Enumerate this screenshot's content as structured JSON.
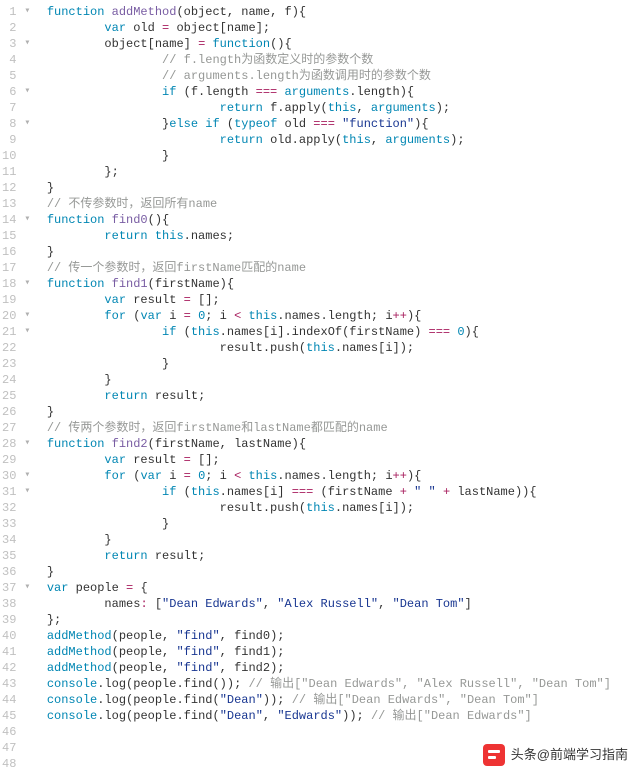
{
  "watermark": "头条@前端学习指南",
  "lines": [
    {
      "n": 1,
      "fold": "▾",
      "indent": 0,
      "tokens": [
        [
          "kw2",
          "function"
        ],
        [
          "",
          ""
        ],
        [
          "fn",
          " addMethod"
        ],
        [
          "",
          "("
        ],
        [
          "id",
          "object"
        ],
        [
          "",
          ", "
        ],
        [
          "id",
          "name"
        ],
        [
          "",
          ", "
        ],
        [
          "id",
          "f"
        ],
        [
          "",
          "){"
        ]
      ]
    },
    {
      "n": 2,
      "fold": "",
      "indent": 2,
      "tokens": [
        [
          "kw2",
          "var"
        ],
        [
          "",
          " "
        ],
        [
          "id",
          "old"
        ],
        [
          "",
          " "
        ],
        [
          "op",
          "="
        ],
        [
          "",
          " "
        ],
        [
          "id",
          "object"
        ],
        [
          "",
          "["
        ],
        [
          "id",
          "name"
        ],
        [
          "",
          "];"
        ]
      ]
    },
    {
      "n": 3,
      "fold": "▾",
      "indent": 2,
      "tokens": [
        [
          "id",
          "object"
        ],
        [
          "",
          "["
        ],
        [
          "id",
          "name"
        ],
        [
          "",
          "] "
        ],
        [
          "op",
          "="
        ],
        [
          "",
          " "
        ],
        [
          "kw2",
          "function"
        ],
        [
          "",
          "(){"
        ]
      ]
    },
    {
      "n": 4,
      "fold": "",
      "indent": 4,
      "tokens": [
        [
          "com",
          "// f.length为函数定义时的参数个数"
        ]
      ]
    },
    {
      "n": 5,
      "fold": "",
      "indent": 4,
      "tokens": [
        [
          "com",
          "// arguments.length为函数调用时的参数个数"
        ]
      ]
    },
    {
      "n": 6,
      "fold": "▾",
      "indent": 4,
      "tokens": [
        [
          "kw2",
          "if"
        ],
        [
          "",
          " ("
        ],
        [
          "id",
          "f"
        ],
        [
          "",
          ".length "
        ],
        [
          "op",
          "==="
        ],
        [
          "",
          " "
        ],
        [
          "builtin",
          "arguments"
        ],
        [
          "",
          ".length){"
        ]
      ]
    },
    {
      "n": 7,
      "fold": "",
      "indent": 6,
      "tokens": [
        [
          "kw2",
          "return"
        ],
        [
          "",
          " "
        ],
        [
          "id",
          "f"
        ],
        [
          "",
          ".apply("
        ],
        [
          "this",
          "this"
        ],
        [
          "",
          ", "
        ],
        [
          "builtin",
          "arguments"
        ],
        [
          "",
          ");"
        ]
      ]
    },
    {
      "n": 8,
      "fold": "▾",
      "indent": 4,
      "tokens": [
        [
          "",
          "}"
        ],
        [
          "kw2",
          "else if"
        ],
        [
          "",
          " ("
        ],
        [
          "kw2",
          "typeof"
        ],
        [
          "",
          " "
        ],
        [
          "id",
          "old"
        ],
        [
          "",
          " "
        ],
        [
          "op",
          "==="
        ],
        [
          "",
          " "
        ],
        [
          "str",
          "\"function\""
        ],
        [
          "",
          "){"
        ]
      ]
    },
    {
      "n": 9,
      "fold": "",
      "indent": 6,
      "tokens": [
        [
          "kw2",
          "return"
        ],
        [
          "",
          " "
        ],
        [
          "id",
          "old"
        ],
        [
          "",
          ".apply("
        ],
        [
          "this",
          "this"
        ],
        [
          "",
          ", "
        ],
        [
          "builtin",
          "arguments"
        ],
        [
          "",
          ");"
        ]
      ]
    },
    {
      "n": 10,
      "fold": "",
      "indent": 4,
      "tokens": [
        [
          "",
          "}"
        ]
      ]
    },
    {
      "n": 11,
      "fold": "",
      "indent": 2,
      "tokens": [
        [
          "",
          "};"
        ]
      ]
    },
    {
      "n": 12,
      "fold": "",
      "indent": 0,
      "tokens": [
        [
          "",
          "}"
        ]
      ]
    },
    {
      "n": 13,
      "fold": "",
      "indent": 0,
      "tokens": [
        [
          "com",
          "// 不传参数时，返回所有name"
        ]
      ]
    },
    {
      "n": 14,
      "fold": "▾",
      "indent": 0,
      "tokens": [
        [
          "kw2",
          "function"
        ],
        [
          "",
          " "
        ],
        [
          "fn",
          "find0"
        ],
        [
          "",
          "(){"
        ]
      ]
    },
    {
      "n": 15,
      "fold": "",
      "indent": 2,
      "tokens": [
        [
          "kw2",
          "return"
        ],
        [
          "",
          " "
        ],
        [
          "this",
          "this"
        ],
        [
          "",
          ".names;"
        ]
      ]
    },
    {
      "n": 16,
      "fold": "",
      "indent": 0,
      "tokens": [
        [
          "",
          "}"
        ]
      ]
    },
    {
      "n": 17,
      "fold": "",
      "indent": 0,
      "tokens": [
        [
          "com",
          "// 传一个参数时，返回firstName匹配的name"
        ]
      ]
    },
    {
      "n": 18,
      "fold": "▾",
      "indent": 0,
      "tokens": [
        [
          "kw2",
          "function"
        ],
        [
          "",
          " "
        ],
        [
          "fn",
          "find1"
        ],
        [
          "",
          "("
        ],
        [
          "id",
          "firstName"
        ],
        [
          "",
          "){"
        ]
      ]
    },
    {
      "n": 19,
      "fold": "",
      "indent": 2,
      "tokens": [
        [
          "kw2",
          "var"
        ],
        [
          "",
          " "
        ],
        [
          "id",
          "result"
        ],
        [
          "",
          " "
        ],
        [
          "op",
          "="
        ],
        [
          "",
          " [];"
        ]
      ]
    },
    {
      "n": 20,
      "fold": "▾",
      "indent": 2,
      "tokens": [
        [
          "kw2",
          "for"
        ],
        [
          "",
          " ("
        ],
        [
          "kw2",
          "var"
        ],
        [
          "",
          " "
        ],
        [
          "id",
          "i"
        ],
        [
          "",
          " "
        ],
        [
          "op",
          "="
        ],
        [
          "",
          " "
        ],
        [
          "num",
          "0"
        ],
        [
          "",
          "; "
        ],
        [
          "id",
          "i"
        ],
        [
          "",
          " "
        ],
        [
          "op",
          "<"
        ],
        [
          "",
          " "
        ],
        [
          "this",
          "this"
        ],
        [
          "",
          ".names.length; "
        ],
        [
          "id",
          "i"
        ],
        [
          "op",
          "++"
        ],
        [
          "",
          "){"
        ]
      ]
    },
    {
      "n": 21,
      "fold": "▾",
      "indent": 4,
      "tokens": [
        [
          "kw2",
          "if"
        ],
        [
          "",
          " ("
        ],
        [
          "this",
          "this"
        ],
        [
          "",
          ".names["
        ],
        [
          "id",
          "i"
        ],
        [
          "",
          "].indexOf("
        ],
        [
          "id",
          "firstName"
        ],
        [
          "",
          ") "
        ],
        [
          "op",
          "==="
        ],
        [
          "",
          " "
        ],
        [
          "num",
          "0"
        ],
        [
          "",
          "){"
        ]
      ]
    },
    {
      "n": 22,
      "fold": "",
      "indent": 6,
      "tokens": [
        [
          "id",
          "result"
        ],
        [
          "",
          ".push("
        ],
        [
          "this",
          "this"
        ],
        [
          "",
          ".names["
        ],
        [
          "id",
          "i"
        ],
        [
          "",
          "]);"
        ]
      ]
    },
    {
      "n": 23,
      "fold": "",
      "indent": 4,
      "tokens": [
        [
          "",
          "}"
        ]
      ]
    },
    {
      "n": 24,
      "fold": "",
      "indent": 2,
      "tokens": [
        [
          "",
          "}"
        ]
      ]
    },
    {
      "n": 25,
      "fold": "",
      "indent": 2,
      "tokens": [
        [
          "kw2",
          "return"
        ],
        [
          "",
          " "
        ],
        [
          "id",
          "result"
        ],
        [
          "",
          ";"
        ]
      ]
    },
    {
      "n": 26,
      "fold": "",
      "indent": 0,
      "tokens": [
        [
          "",
          "}"
        ]
      ]
    },
    {
      "n": 27,
      "fold": "",
      "indent": 0,
      "tokens": [
        [
          "com",
          "// 传两个参数时，返回firstName和lastName都匹配的name"
        ]
      ]
    },
    {
      "n": 28,
      "fold": "▾",
      "indent": 0,
      "tokens": [
        [
          "kw2",
          "function"
        ],
        [
          "",
          " "
        ],
        [
          "fn",
          "find2"
        ],
        [
          "",
          "("
        ],
        [
          "id",
          "firstName"
        ],
        [
          "",
          ", "
        ],
        [
          "id",
          "lastName"
        ],
        [
          "",
          "){"
        ]
      ]
    },
    {
      "n": 29,
      "fold": "",
      "indent": 2,
      "tokens": [
        [
          "kw2",
          "var"
        ],
        [
          "",
          " "
        ],
        [
          "id",
          "result"
        ],
        [
          "",
          " "
        ],
        [
          "op",
          "="
        ],
        [
          "",
          " [];"
        ]
      ]
    },
    {
      "n": 30,
      "fold": "▾",
      "indent": 2,
      "tokens": [
        [
          "kw2",
          "for"
        ],
        [
          "",
          " ("
        ],
        [
          "kw2",
          "var"
        ],
        [
          "",
          " "
        ],
        [
          "id",
          "i"
        ],
        [
          "",
          " "
        ],
        [
          "op",
          "="
        ],
        [
          "",
          " "
        ],
        [
          "num",
          "0"
        ],
        [
          "",
          "; "
        ],
        [
          "id",
          "i"
        ],
        [
          "",
          " "
        ],
        [
          "op",
          "<"
        ],
        [
          "",
          " "
        ],
        [
          "this",
          "this"
        ],
        [
          "",
          ".names.length; "
        ],
        [
          "id",
          "i"
        ],
        [
          "op",
          "++"
        ],
        [
          "",
          "){"
        ]
      ]
    },
    {
      "n": 31,
      "fold": "▾",
      "indent": 4,
      "tokens": [
        [
          "kw2",
          "if"
        ],
        [
          "",
          " ("
        ],
        [
          "this",
          "this"
        ],
        [
          "",
          ".names["
        ],
        [
          "id",
          "i"
        ],
        [
          "",
          "] "
        ],
        [
          "op",
          "==="
        ],
        [
          "",
          " ("
        ],
        [
          "id",
          "firstName"
        ],
        [
          "",
          " "
        ],
        [
          "op",
          "+"
        ],
        [
          "",
          " "
        ],
        [
          "str",
          "\" \""
        ],
        [
          "",
          " "
        ],
        [
          "op",
          "+"
        ],
        [
          "",
          " "
        ],
        [
          "id",
          "lastName"
        ],
        [
          "",
          ")){"
        ]
      ]
    },
    {
      "n": 32,
      "fold": "",
      "indent": 6,
      "tokens": [
        [
          "id",
          "result"
        ],
        [
          "",
          ".push("
        ],
        [
          "this",
          "this"
        ],
        [
          "",
          ".names["
        ],
        [
          "id",
          "i"
        ],
        [
          "",
          "]);"
        ]
      ]
    },
    {
      "n": 33,
      "fold": "",
      "indent": 4,
      "tokens": [
        [
          "",
          "}"
        ]
      ]
    },
    {
      "n": 34,
      "fold": "",
      "indent": 2,
      "tokens": [
        [
          "",
          "}"
        ]
      ]
    },
    {
      "n": 35,
      "fold": "",
      "indent": 2,
      "tokens": [
        [
          "kw2",
          "return"
        ],
        [
          "",
          " "
        ],
        [
          "id",
          "result"
        ],
        [
          "",
          ";"
        ]
      ]
    },
    {
      "n": 36,
      "fold": "",
      "indent": 0,
      "tokens": [
        [
          "",
          "}"
        ]
      ]
    },
    {
      "n": 37,
      "fold": "▾",
      "indent": 0,
      "tokens": [
        [
          "kw2",
          "var"
        ],
        [
          "",
          " "
        ],
        [
          "id",
          "people"
        ],
        [
          "",
          " "
        ],
        [
          "op",
          "="
        ],
        [
          "",
          " {"
        ]
      ]
    },
    {
      "n": 38,
      "fold": "",
      "indent": 2,
      "tokens": [
        [
          "id",
          "names"
        ],
        [
          "op",
          ":"
        ],
        [
          "",
          " ["
        ],
        [
          "str",
          "\"Dean Edwards\""
        ],
        [
          "",
          ", "
        ],
        [
          "str",
          "\"Alex Russell\""
        ],
        [
          "",
          ", "
        ],
        [
          "str",
          "\"Dean Tom\""
        ],
        [
          "",
          "]"
        ]
      ]
    },
    {
      "n": 39,
      "fold": "",
      "indent": 0,
      "tokens": [
        [
          "",
          "};"
        ]
      ]
    },
    {
      "n": 40,
      "fold": "",
      "indent": 0,
      "tokens": [
        [
          "call",
          "addMethod"
        ],
        [
          "",
          "("
        ],
        [
          "id",
          "people"
        ],
        [
          "",
          ", "
        ],
        [
          "str",
          "\"find\""
        ],
        [
          "",
          ", "
        ],
        [
          "id",
          "find0"
        ],
        [
          "",
          ");"
        ]
      ]
    },
    {
      "n": 41,
      "fold": "",
      "indent": 0,
      "tokens": [
        [
          "call",
          "addMethod"
        ],
        [
          "",
          "("
        ],
        [
          "id",
          "people"
        ],
        [
          "",
          ", "
        ],
        [
          "str",
          "\"find\""
        ],
        [
          "",
          ", "
        ],
        [
          "id",
          "find1"
        ],
        [
          "",
          ");"
        ]
      ]
    },
    {
      "n": 42,
      "fold": "",
      "indent": 0,
      "tokens": [
        [
          "call",
          "addMethod"
        ],
        [
          "",
          "("
        ],
        [
          "id",
          "people"
        ],
        [
          "",
          ", "
        ],
        [
          "str",
          "\"find\""
        ],
        [
          "",
          ", "
        ],
        [
          "id",
          "find2"
        ],
        [
          "",
          ");"
        ]
      ]
    },
    {
      "n": 43,
      "fold": "",
      "indent": 0,
      "tokens": [
        [
          "builtin",
          "console"
        ],
        [
          "",
          ".log("
        ],
        [
          "id",
          "people"
        ],
        [
          "",
          ".find()); "
        ],
        [
          "com",
          "// 输出[\"Dean Edwards\", \"Alex Russell\", \"Dean Tom\"]"
        ]
      ]
    },
    {
      "n": 44,
      "fold": "",
      "indent": 0,
      "tokens": [
        [
          "builtin",
          "console"
        ],
        [
          "",
          ".log("
        ],
        [
          "id",
          "people"
        ],
        [
          "",
          ".find("
        ],
        [
          "str",
          "\"Dean\""
        ],
        [
          "",
          ")); "
        ],
        [
          "com",
          "// 输出[\"Dean Edwards\", \"Dean Tom\"]"
        ]
      ]
    },
    {
      "n": 45,
      "fold": "",
      "indent": 0,
      "tokens": [
        [
          "builtin",
          "console"
        ],
        [
          "",
          ".log("
        ],
        [
          "id",
          "people"
        ],
        [
          "",
          ".find("
        ],
        [
          "str",
          "\"Dean\""
        ],
        [
          "",
          ", "
        ],
        [
          "str",
          "\"Edwards\""
        ],
        [
          "",
          ")); "
        ],
        [
          "com",
          "// 输出[\"Dean Edwards\"]"
        ]
      ]
    },
    {
      "n": 46,
      "fold": "",
      "indent": 0,
      "tokens": []
    },
    {
      "n": 47,
      "fold": "",
      "indent": 0,
      "tokens": []
    },
    {
      "n": 48,
      "fold": "",
      "indent": 0,
      "tokens": []
    }
  ]
}
